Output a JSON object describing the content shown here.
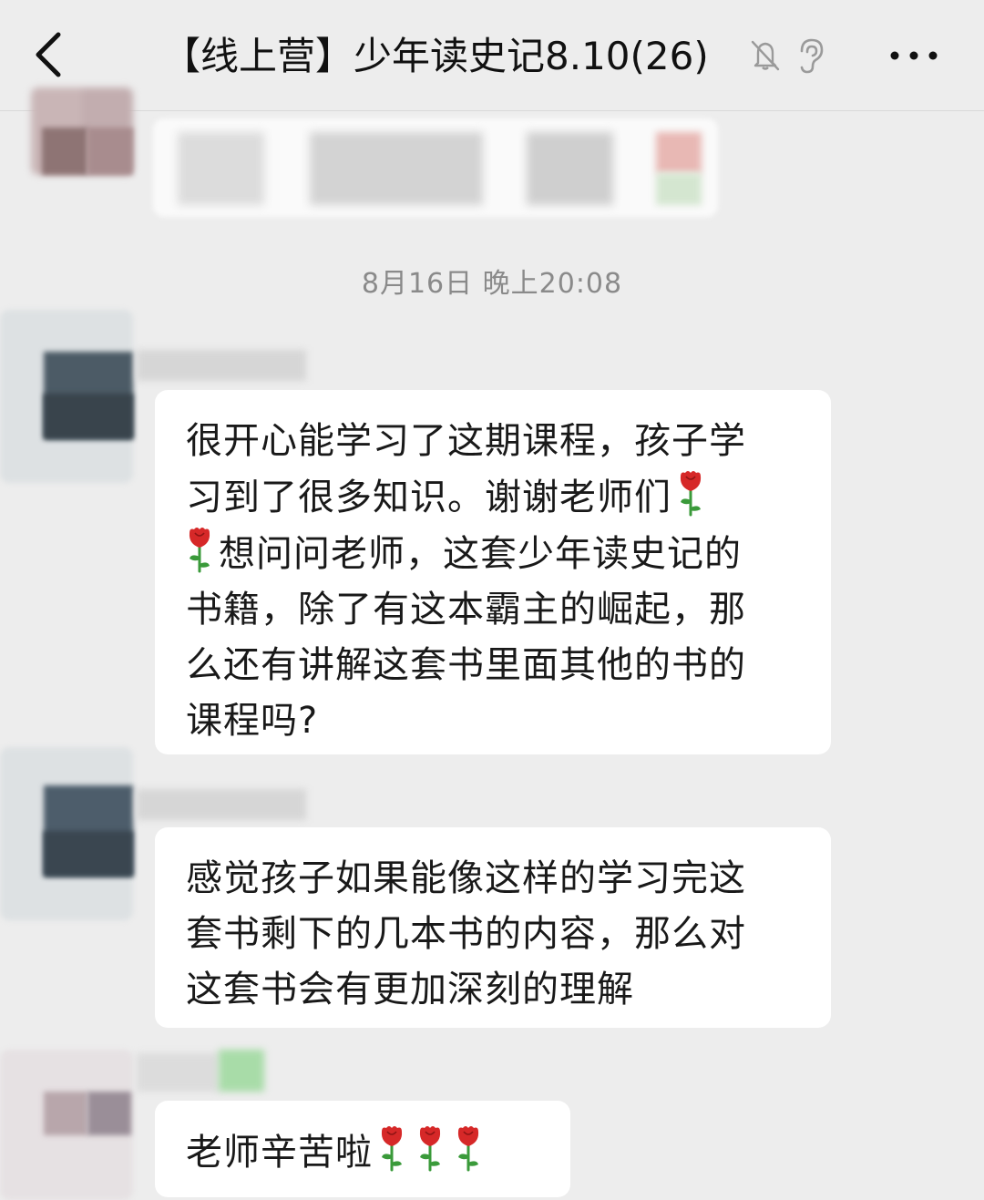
{
  "header": {
    "title": "【线上营】少年读史记8.10(26)",
    "back_icon": "chevron-left-icon",
    "mute_icon": "bell-muted-icon",
    "ear_icon": "ear-icon",
    "more_icon": "more-dots-icon"
  },
  "chat": {
    "timestamp": "8月16日 晚上20:08",
    "messages": [
      {
        "lines": [
          "很开心能学习了这期课程，孩子学",
          "习到了很多知识。谢谢老师们",
          "想问问老师，这套少年读史记的",
          "书籍，除了有这本霸主的崛起，那",
          "么还有讲解这套书里面其他的书的",
          "课程吗?"
        ],
        "emoji": "rose"
      },
      {
        "lines": [
          "感觉孩子如果能像这样的学习完这",
          "套书剩下的几本书的内容，那么对",
          "这套书会有更加深刻的理解"
        ]
      },
      {
        "text": "老师辛苦啦",
        "emoji": "rose",
        "emoji_count": 3
      }
    ]
  },
  "colors": {
    "background": "#ededed",
    "bubble": "#ffffff",
    "timestamp": "#8a8a8a",
    "rose_red": "#d62828",
    "stem_green": "#3a9a3a"
  }
}
